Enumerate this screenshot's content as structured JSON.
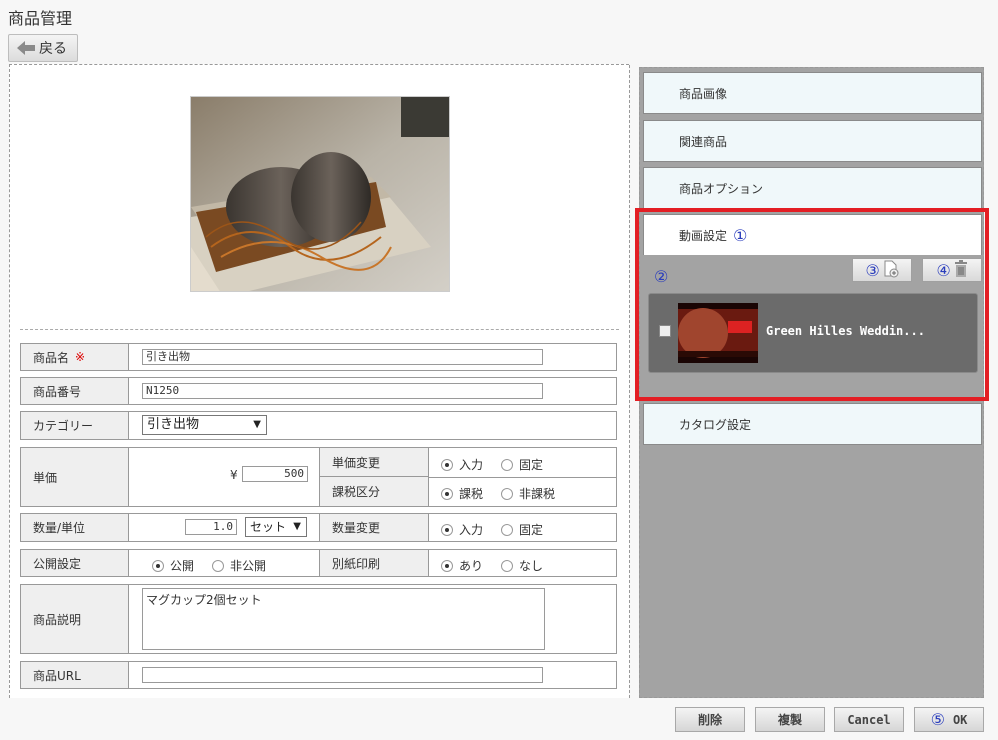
{
  "page_title": "商品管理",
  "back_label": "戻る",
  "form": {
    "name_label": "商品名",
    "required_mark": "※",
    "name_value": "引き出物",
    "number_label": "商品番号",
    "number_value": "N1250",
    "category_label": "カテゴリー",
    "category_value": "引き出物",
    "price_label": "単価",
    "currency": "¥",
    "price_value": "500",
    "price_change_label": "単価変更",
    "price_change_opts": [
      "入力",
      "固定"
    ],
    "tax_label": "課税区分",
    "tax_opts": [
      "課税",
      "非課税"
    ],
    "qty_label": "数量/単位",
    "qty_value": "1.0",
    "unit_value": "セット",
    "qty_change_label": "数量変更",
    "qty_change_opts": [
      "入力",
      "固定"
    ],
    "public_label": "公開設定",
    "public_opts": [
      "公開",
      "非公開"
    ],
    "print_label": "別紙印刷",
    "print_opts": [
      "あり",
      "なし"
    ],
    "desc_label": "商品説明",
    "desc_value": "マグカップ2個セット",
    "url_label": "商品URL",
    "url_value": ""
  },
  "sidebar": {
    "items": [
      "商品画像",
      "関連商品",
      "商品オプション",
      "動画設定",
      "カタログ設定"
    ],
    "badge1": "①",
    "badge2": "②",
    "badge3": "③",
    "badge4": "④",
    "video_title": "Green Hilles Weddin..."
  },
  "footer": {
    "delete": "削除",
    "copy": "複製",
    "cancel": "Cancel",
    "badge5": "⑤",
    "ok": "OK"
  },
  "colors": {
    "highlight": "#e31e24",
    "badge": "#2a3dbd",
    "panel_bg": "#a3a3a3"
  }
}
